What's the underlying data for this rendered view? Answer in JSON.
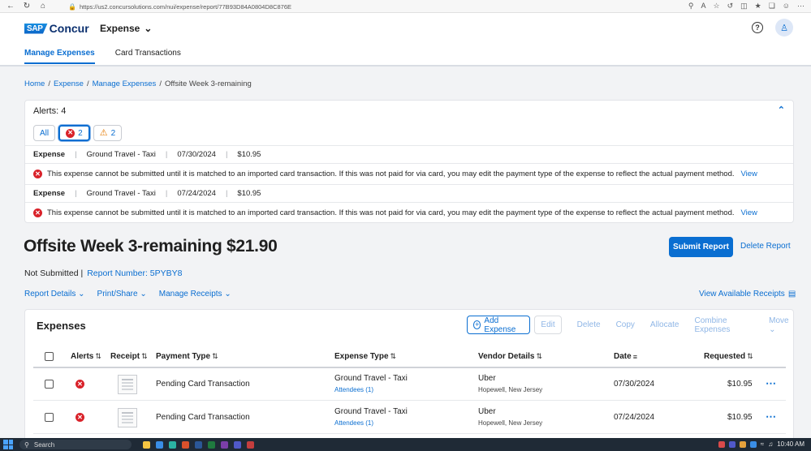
{
  "browser": {
    "url": "https://us2.concursolutions.com/nui/expense/report/77B93D84A0804D8C876E"
  },
  "header": {
    "logo_sap": "SAP",
    "logo_concur": "Concur",
    "product": "Expense",
    "tabs": [
      {
        "label": "Manage Expenses",
        "active": true
      },
      {
        "label": "Card Transactions",
        "active": false
      }
    ]
  },
  "breadcrumb": {
    "home": "Home",
    "expense": "Expense",
    "manage": "Manage Expenses",
    "current": "Offsite Week 3-remaining",
    "sep": "/"
  },
  "alerts": {
    "title": "Alerts: 4",
    "filter_all": "All",
    "error_count": "2",
    "warning_count": "2",
    "items": [
      {
        "label": "Expense",
        "type": "Ground Travel - Taxi",
        "date": "07/30/2024",
        "amount": "$10.95",
        "message": "This expense cannot be submitted until it is matched to an imported card transaction. If this was not paid for via card, you may edit the payment type of the expense to reflect the actual payment method.",
        "link": "View"
      },
      {
        "label": "Expense",
        "type": "Ground Travel - Taxi",
        "date": "07/24/2024",
        "amount": "$10.95",
        "message": "This expense cannot be submitted until it is matched to an imported card transaction. If this was not paid for via card, you may edit the payment type of the expense to reflect the actual payment method.",
        "link": "View"
      }
    ]
  },
  "report": {
    "title": "Offsite Week 3-remaining $21.90",
    "submit_label": "Submit Report",
    "delete_label": "Delete Report",
    "status": "Not Submitted |",
    "report_number": "Report Number: 5PYBY8",
    "actions": [
      "Report Details",
      "Print/Share",
      "Manage Receipts"
    ],
    "view_receipts": "View Available Receipts"
  },
  "expenses": {
    "title": "Expenses",
    "toolbar": {
      "add": "Add Expense",
      "edit": "Edit",
      "delete": "Delete",
      "copy": "Copy",
      "allocate": "Allocate",
      "combine": "Combine Expenses",
      "move": "Move"
    },
    "columns": {
      "alerts": "Alerts",
      "receipt": "Receipt",
      "payment_type": "Payment Type",
      "expense_type": "Expense Type",
      "vendor": "Vendor Details",
      "date": "Date",
      "requested": "Requested"
    },
    "rows": [
      {
        "payment_type": "Pending Card Transaction",
        "expense_type": "Ground Travel - Taxi",
        "attendees": "Attendees (1)",
        "vendor": "Uber",
        "location": "Hopewell, New Jersey",
        "date": "07/30/2024",
        "requested": "$10.95"
      },
      {
        "payment_type": "Pending Card Transaction",
        "expense_type": "Ground Travel - Taxi",
        "attendees": "Attendees (1)",
        "vendor": "Uber",
        "location": "Hopewell, New Jersey",
        "date": "07/24/2024",
        "requested": "$10.95"
      }
    ]
  },
  "taskbar": {
    "search": "Search",
    "time": "10:40 AM"
  },
  "colors": {
    "accent": "#0a6ed1",
    "error": "#d9222a",
    "warning": "#e57a00"
  }
}
